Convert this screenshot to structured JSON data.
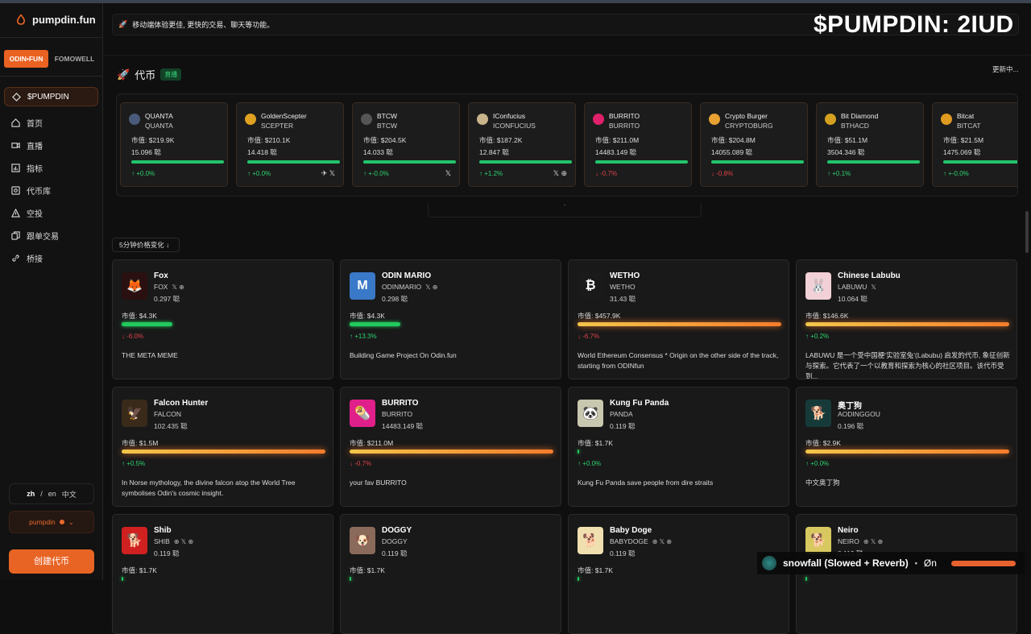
{
  "app": {
    "title": "pumpdin.fun"
  },
  "sidebar": {
    "tabs": [
      "ODIN•FUN",
      "FOMOWELL"
    ],
    "items": [
      {
        "label": "$PUMPDIN",
        "icon": "diamond-icon",
        "active": true
      },
      {
        "label": "首页",
        "icon": "home-icon"
      },
      {
        "label": "直播",
        "icon": "video-icon"
      },
      {
        "label": "指标",
        "icon": "chart-icon"
      },
      {
        "label": "代币库",
        "icon": "vault-icon"
      },
      {
        "label": "空投",
        "icon": "airdrop-icon"
      },
      {
        "label": "跟单交易",
        "icon": "copy-icon"
      },
      {
        "label": "桥接",
        "icon": "link-icon"
      }
    ],
    "lang": {
      "zh": "zh",
      "slash": "/",
      "en": "en",
      "current": "中文"
    },
    "user": "pumpdin",
    "create_label": "创建代币"
  },
  "notice": "移动端体验更佳, 更快的交易、聊天等功能。",
  "overlay_title": "$PUMPDIN: 2IUD",
  "section": {
    "title": "代币",
    "badge": "直播",
    "updating": "更新中..."
  },
  "carousel": [
    {
      "name": "QUANTA",
      "ticker": "QUANTA",
      "mcap": "市值: $219.9K",
      "holders": "15.096 聪",
      "progress": 1.0,
      "change": "↑ +0.0%",
      "dir": "up",
      "social": "",
      "color": "#4a5a7a"
    },
    {
      "name": "GoldenScepter",
      "ticker": "SCEPTER",
      "mcap": "市值: $210.1K",
      "holders": "14.418 聪",
      "progress": 1.0,
      "change": "↑ +0.0%",
      "dir": "up",
      "social": "✈ 𝕏",
      "color": "#e0a020"
    },
    {
      "name": "BTCW",
      "ticker": "BTCW",
      "mcap": "市值: $204.5K",
      "holders": "14.033 聪",
      "progress": 1.0,
      "change": "↑ +-0.0%",
      "dir": "up",
      "social": "𝕏",
      "color": "#555"
    },
    {
      "name": "IConfucius",
      "ticker": "ICONFUCIUS",
      "mcap": "市值: $187.2K",
      "holders": "12.847 聪",
      "progress": 1.0,
      "change": "↑ +1.2%",
      "dir": "up",
      "social": "𝕏 ⊕",
      "color": "#c8b48a"
    },
    {
      "name": "BURRITO",
      "ticker": "BURRITO",
      "mcap": "市值: $211.0M",
      "holders": "14483.149 聪",
      "progress": 1.0,
      "change": "↓ -0.7%",
      "dir": "dn",
      "social": "",
      "color": "#e0206a"
    },
    {
      "name": "Crypto Burger",
      "ticker": "CRYPTOBURG",
      "mcap": "市值: $204.8M",
      "holders": "14055.089 聪",
      "progress": 1.0,
      "change": "↓ -0.8%",
      "dir": "dn",
      "social": "",
      "color": "#e8a030"
    },
    {
      "name": "Bit Diamond",
      "ticker": "BTHACD",
      "mcap": "市值: $51.1M",
      "holders": "3504.346 聪",
      "progress": 1.0,
      "change": "↑ +0.1%",
      "dir": "up",
      "social": "",
      "color": "#d4a020"
    },
    {
      "name": "Bitcat",
      "ticker": "BITCAT",
      "mcap": "市值: $21.5M",
      "holders": "1475.069 聪",
      "progress": 1.0,
      "change": "↑ +-0.0%",
      "dir": "up",
      "social": "",
      "color": "#e09a20"
    }
  ],
  "pager": "·",
  "sort_label": "5分钟价格变化 ↓",
  "tokens": [
    {
      "name": "Fox",
      "ticker": "FOX",
      "social": "𝕏 ⊕",
      "holders": "0.297 聪",
      "mcap": "市值: $4.3K",
      "progress": 0.25,
      "bar": "g",
      "change": "↓ -6.0%",
      "dir": "dn",
      "desc": "THE META MEME",
      "color": "#2a1010",
      "glyph": "🦊"
    },
    {
      "name": "ODIN MARIO",
      "ticker": "ODINMARIO",
      "social": "𝕏 ⊕",
      "holders": "0.298 聪",
      "mcap": "市值: $4.3K",
      "progress": 0.25,
      "bar": "g",
      "change": "↑ +13.3%",
      "dir": "up",
      "desc": "Building Game Project On Odin.fun",
      "color": "#3a78c8",
      "glyph": "M"
    },
    {
      "name": "WETHO",
      "ticker": "WETHO",
      "social": "",
      "holders": "31.43 聪",
      "mcap": "市值: $457.9K",
      "progress": 1.0,
      "bar": "o",
      "change": "↓ -6.7%",
      "dir": "dn",
      "desc": "World Ethereum Consensus * Origin on the other side of the track, starting from ODINfun",
      "color": "#1a1a1a",
      "glyph": "₿"
    },
    {
      "name": "Chinese Labubu",
      "ticker": "LABUWU",
      "social": "𝕏",
      "holders": "10.064 聪",
      "mcap": "市值: $146.6K",
      "progress": 1.0,
      "bar": "o",
      "change": "↑ +0.2%",
      "dir": "up",
      "desc": "LABUWU 是一个受中国梗‘实验室兔’(Labubu) 启发的代币, 象征创新与探索。它代表了一个以教育和探索为核心的社区项目。该代币受到...",
      "color": "#f2d0d8",
      "glyph": "🐰"
    },
    {
      "name": "Falcon Hunter",
      "ticker": "FALCON",
      "social": "",
      "holders": "102.435 聪",
      "mcap": "市值: $1.5M",
      "progress": 1.0,
      "bar": "o",
      "change": "↑ +0.5%",
      "dir": "up",
      "desc": "In Norse mythology, the divine falcon atop the World Tree symbolises Odin's cosmic insight.",
      "color": "#3a2a1a",
      "glyph": "🦅"
    },
    {
      "name": "BURRITO",
      "ticker": "BURRITO",
      "social": "",
      "holders": "14483.149 聪",
      "mcap": "市值: $211.0M",
      "progress": 1.0,
      "bar": "o",
      "change": "↓ -0.7%",
      "dir": "dn",
      "desc": "your fav BURRITO",
      "color": "#e0208a",
      "glyph": "🌯"
    },
    {
      "name": "Kung Fu Panda",
      "ticker": "PANDA",
      "social": "",
      "holders": "0.119 聪",
      "mcap": "市值: $1.7K",
      "progress": 0.0,
      "bar": "g",
      "change": "↑ +0.0%",
      "dir": "up",
      "desc": "Kung Fu Panda save people from dire straits",
      "color": "#c8c8b0",
      "glyph": "🐼"
    },
    {
      "name": "奥丁狗",
      "ticker": "AODINGGOU",
      "social": "",
      "holders": "0.196 聪",
      "mcap": "市值: $2.9K",
      "progress": 1.0,
      "bar": "o",
      "change": "↑ +0.0%",
      "dir": "up",
      "desc": "中文奥丁狗",
      "color": "#163a3a",
      "glyph": "🐕"
    },
    {
      "name": "Shib",
      "ticker": "SHIB",
      "social": "⊕ 𝕏 ⊕",
      "holders": "0.119 聪",
      "mcap": "市值: $1.7K",
      "progress": 0.0,
      "bar": "g",
      "change": "",
      "dir": "up",
      "desc": "",
      "color": "#d02020",
      "glyph": "🐕"
    },
    {
      "name": "DOGGY",
      "ticker": "DOGGY",
      "social": "",
      "holders": "0.119 聪",
      "mcap": "市值: $1.7K",
      "progress": 0.0,
      "bar": "g",
      "change": "",
      "dir": "up",
      "desc": "",
      "color": "#8a6a5a",
      "glyph": "🐶"
    },
    {
      "name": "Baby Doge",
      "ticker": "BABYDOGE",
      "social": "⊕ 𝕏 ⊕",
      "holders": "0.119 聪",
      "mcap": "市值: $1.7K",
      "progress": 0.0,
      "bar": "g",
      "change": "",
      "dir": "up",
      "desc": "",
      "color": "#f0e0b0",
      "glyph": "🐕"
    },
    {
      "name": "Neiro",
      "ticker": "NEIRO",
      "social": "⊕ 𝕏 ⊕",
      "holders": "0.119 聪",
      "mcap": "",
      "progress": 0.0,
      "bar": "g",
      "change": "",
      "dir": "up",
      "desc": "",
      "color": "#d8c860",
      "glyph": "🐕"
    }
  ],
  "media": {
    "track": "snowfall (Slowed + Reverb)",
    "dot": "•",
    "artist": "Øn"
  }
}
